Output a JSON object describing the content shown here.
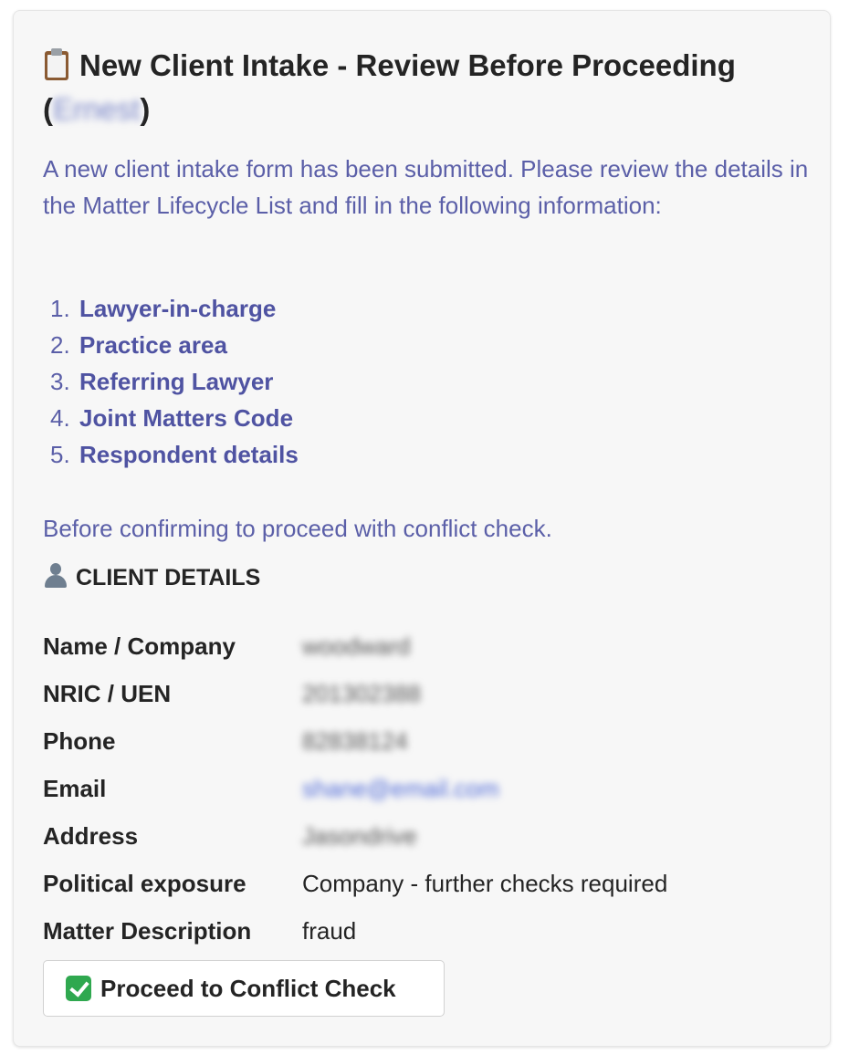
{
  "card": {
    "title_text": "New Client Intake - Review Before Proceeding",
    "title_open_paren": "(",
    "title_name": "Ernest",
    "title_close_paren": ")",
    "intro": "A new client intake form has been submitted. Please review the details in the Matter Lifecycle List and fill in the following information:",
    "steps": [
      {
        "num": "1.",
        "label": "Lawyer-in-charge"
      },
      {
        "num": "2.",
        "label": "Practice area"
      },
      {
        "num": "3.",
        "label": "Referring Lawyer"
      },
      {
        "num": "4.",
        "label": "Joint Matters Code"
      },
      {
        "num": "5.",
        "label": "Respondent details"
      }
    ],
    "before": "Before confirming to proceed with conflict check.",
    "section_title": "CLIENT DETAILS",
    "details": [
      {
        "key": "Name / Company",
        "value": "woodward"
      },
      {
        "key": "NRIC / UEN",
        "value": "201302388"
      },
      {
        "key": "Phone",
        "value": "82838124"
      },
      {
        "key": "Email",
        "value": "shane@email.com"
      },
      {
        "key": "Address",
        "value": "Jasondrive"
      },
      {
        "key": "Political exposure",
        "value": "Company - further checks required"
      },
      {
        "key": "Matter Description",
        "value": "fraud"
      }
    ],
    "proceed_label": "Proceed to Conflict Check",
    "icons": {
      "title": "clipboard-icon",
      "section": "person-icon",
      "button": "check-mark-button-icon"
    }
  }
}
